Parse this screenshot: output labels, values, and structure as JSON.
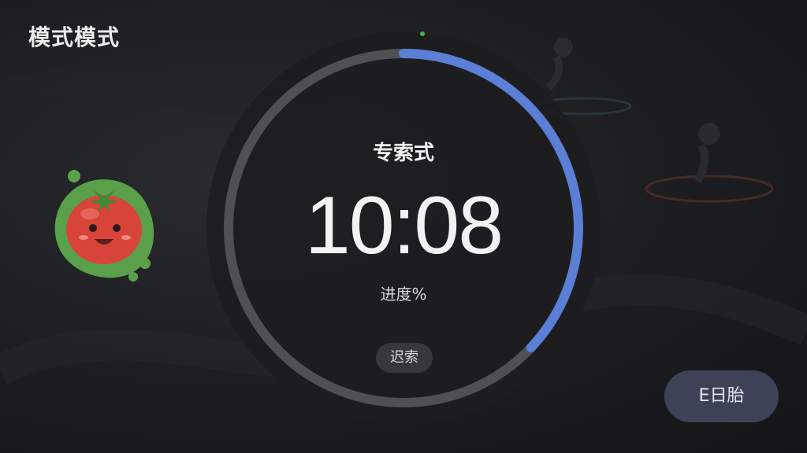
{
  "app": {
    "title": "模式模式"
  },
  "timer": {
    "mode_label": "专索式",
    "time": "10:08",
    "progress_label": "进度%",
    "progress_fraction": 0.37,
    "pill_label": "迟索"
  },
  "actions": {
    "primary_label": "E日胎"
  },
  "icons": {
    "mascot": "tomato-mascot-icon"
  },
  "colors": {
    "progress_arc": "#5b7fd6",
    "track": "#5a5b5f",
    "dial_bg": "#1d1e21",
    "button_bg": "#3e4257"
  }
}
